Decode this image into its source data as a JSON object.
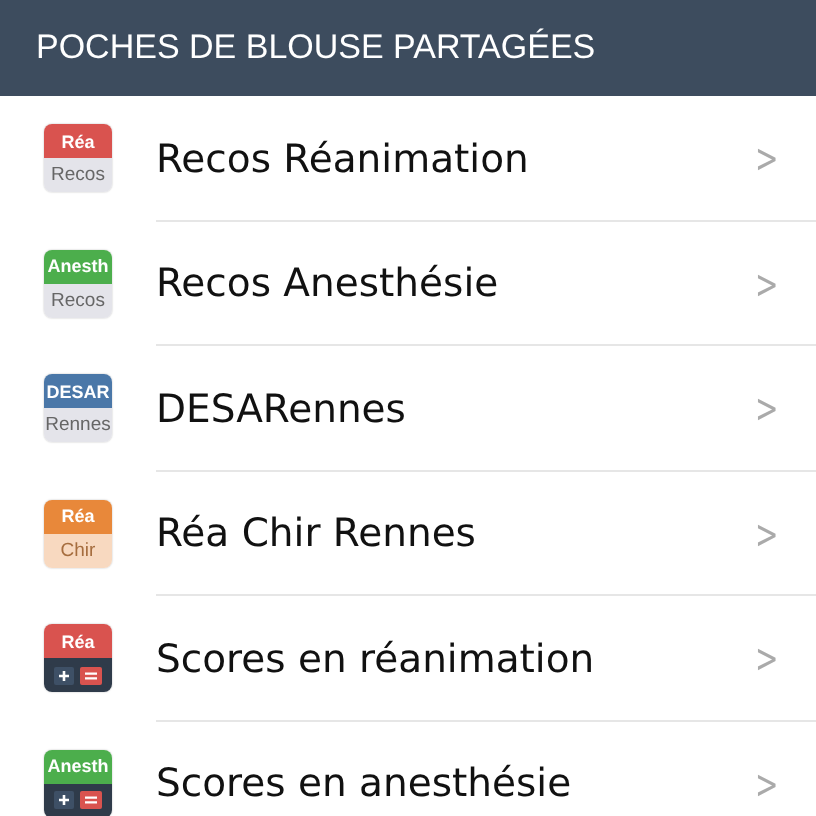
{
  "header": {
    "title": "POCHES DE BLOUSE PARTAGÉES"
  },
  "items": [
    {
      "label": "Recos Réanimation",
      "chevron": ">",
      "icon": {
        "kind": "label",
        "top": "Réa",
        "bottom": "Recos",
        "color": "#d9534f",
        "tinted": false
      }
    },
    {
      "label": "Recos Anesthésie",
      "chevron": ">",
      "icon": {
        "kind": "label",
        "top": "Anesth",
        "bottom": "Recos",
        "color": "#4cae4c",
        "tinted": false
      }
    },
    {
      "label": "DESARennes",
      "chevron": ">",
      "icon": {
        "kind": "label",
        "top": "DESAR",
        "bottom": "Rennes",
        "color": "#4a77a8",
        "tinted": false
      }
    },
    {
      "label": "Réa Chir Rennes",
      "chevron": ">",
      "icon": {
        "kind": "label",
        "top": "Réa",
        "bottom": "Chir",
        "color": "#e8883a",
        "tinted": true
      }
    },
    {
      "label": "Scores en réanimation",
      "chevron": ">",
      "icon": {
        "kind": "calculator",
        "top": "Réa",
        "color": "#d9534f"
      }
    },
    {
      "label": "Scores en anesthésie",
      "chevron": ">",
      "icon": {
        "kind": "calculator",
        "top": "Anesth",
        "color": "#4cae4c"
      }
    }
  ]
}
